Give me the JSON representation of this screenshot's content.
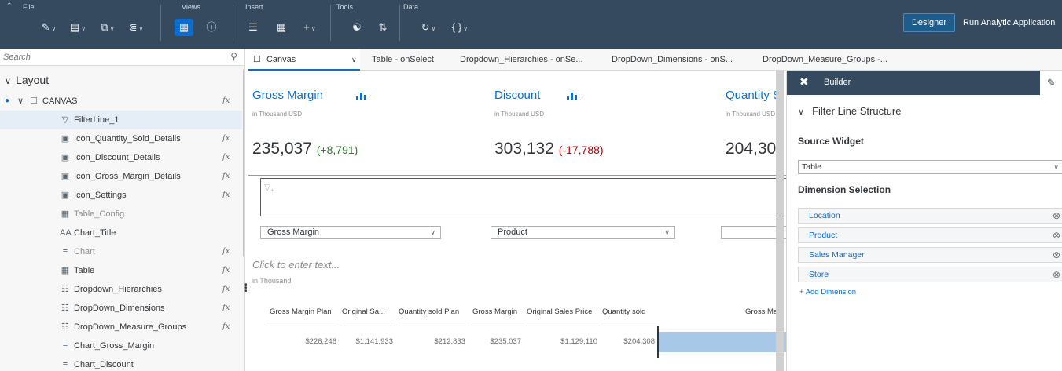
{
  "toolbar": {
    "file_label": "File",
    "views_label": "Views",
    "insert_label": "Insert",
    "tools_label": "Tools",
    "data_label": "Data",
    "designer_label": "Designer",
    "run_label": "Run Analytic Application"
  },
  "outline": {
    "search_placeholder": "Search",
    "layout_label": "Layout",
    "items": [
      {
        "label": "CANVAS",
        "icon": "canvas-icon",
        "fx": true
      },
      {
        "label": "FilterLine_1",
        "icon": "filter-icon",
        "fx": false
      },
      {
        "label": "Icon_Quantity_Sold_Details",
        "icon": "image-icon",
        "fx": true
      },
      {
        "label": "Icon_Discount_Details",
        "icon": "image-icon",
        "fx": true
      },
      {
        "label": "Icon_Gross_Margin_Details",
        "icon": "image-icon",
        "fx": true
      },
      {
        "label": "Icon_Settings",
        "icon": "image-icon",
        "fx": true
      },
      {
        "label": "Table_Config",
        "icon": "table-icon",
        "fx": false
      },
      {
        "label": "Chart_Title",
        "icon": "text-icon",
        "fx": false
      },
      {
        "label": "Chart",
        "icon": "chart-icon",
        "fx": true
      },
      {
        "label": "Table",
        "icon": "table-icon",
        "fx": true
      },
      {
        "label": "Dropdown_Hierarchies",
        "icon": "dropdown-icon",
        "fx": true
      },
      {
        "label": "DropDown_Dimensions",
        "icon": "dropdown-icon",
        "fx": true
      },
      {
        "label": "DropDown_Measure_Groups",
        "icon": "dropdown-icon",
        "fx": true
      },
      {
        "label": "Chart_Gross_Margin",
        "icon": "chart-icon",
        "fx": false
      },
      {
        "label": "Chart_Discount",
        "icon": "chart-icon",
        "fx": false
      }
    ],
    "fx_label": "fx"
  },
  "tabs": [
    {
      "label": "Canvas"
    },
    {
      "label": "Table - onSelect"
    },
    {
      "label": "Dropdown_Hierarchies - onSe..."
    },
    {
      "label": "DropDown_Dimensions - onS..."
    },
    {
      "label": "DropDown_Measure_Groups -..."
    }
  ],
  "canvas": {
    "kpis": [
      {
        "title": "Gross Margin",
        "subtitle": "in Thousand USD",
        "value": "235,037",
        "delta": "(+8,791)",
        "delta_color": "#2b7c2b"
      },
      {
        "title": "Discount",
        "subtitle": "in Thousand USD",
        "value": "303,132",
        "delta": "(-17,788)",
        "delta_color": "#bb0000"
      },
      {
        "title": "Quantity S",
        "subtitle": "in Thousand USD",
        "value": "204,30",
        "delta": "",
        "delta_color": "#32363a"
      }
    ],
    "dropdowns": [
      {
        "value": "Gross Margin"
      },
      {
        "value": "Product"
      },
      {
        "value": ""
      }
    ],
    "chart_title_placeholder": "Click to enter text...",
    "unit_label": "in Thousand",
    "table": {
      "headers": [
        "Gross Margin Plan",
        "Original Sa...",
        "Quantity sold Plan",
        "Gross Margin",
        "Original Sales Price",
        "Quantity sold"
      ],
      "values": [
        "$226,246",
        "$1,141,933",
        "$212,833",
        "$235,037",
        "$1,129,110",
        "$204,308"
      ]
    },
    "chart_header": "Gross Ma"
  },
  "builder": {
    "title": "Builder",
    "section_header": "Filter Line Structure",
    "source_widget_label": "Source Widget",
    "source_widget_value": "Table",
    "dimension_selection_label": "Dimension Selection",
    "dimensions": [
      "Location",
      "Product",
      "Sales Manager",
      "Store"
    ],
    "add_dimension_label": "+ Add Dimension"
  },
  "colors": {
    "shell": "#354a5f",
    "accent": "#0a6ed1",
    "positive": "#2b7c2b",
    "negative": "#bb0000"
  }
}
